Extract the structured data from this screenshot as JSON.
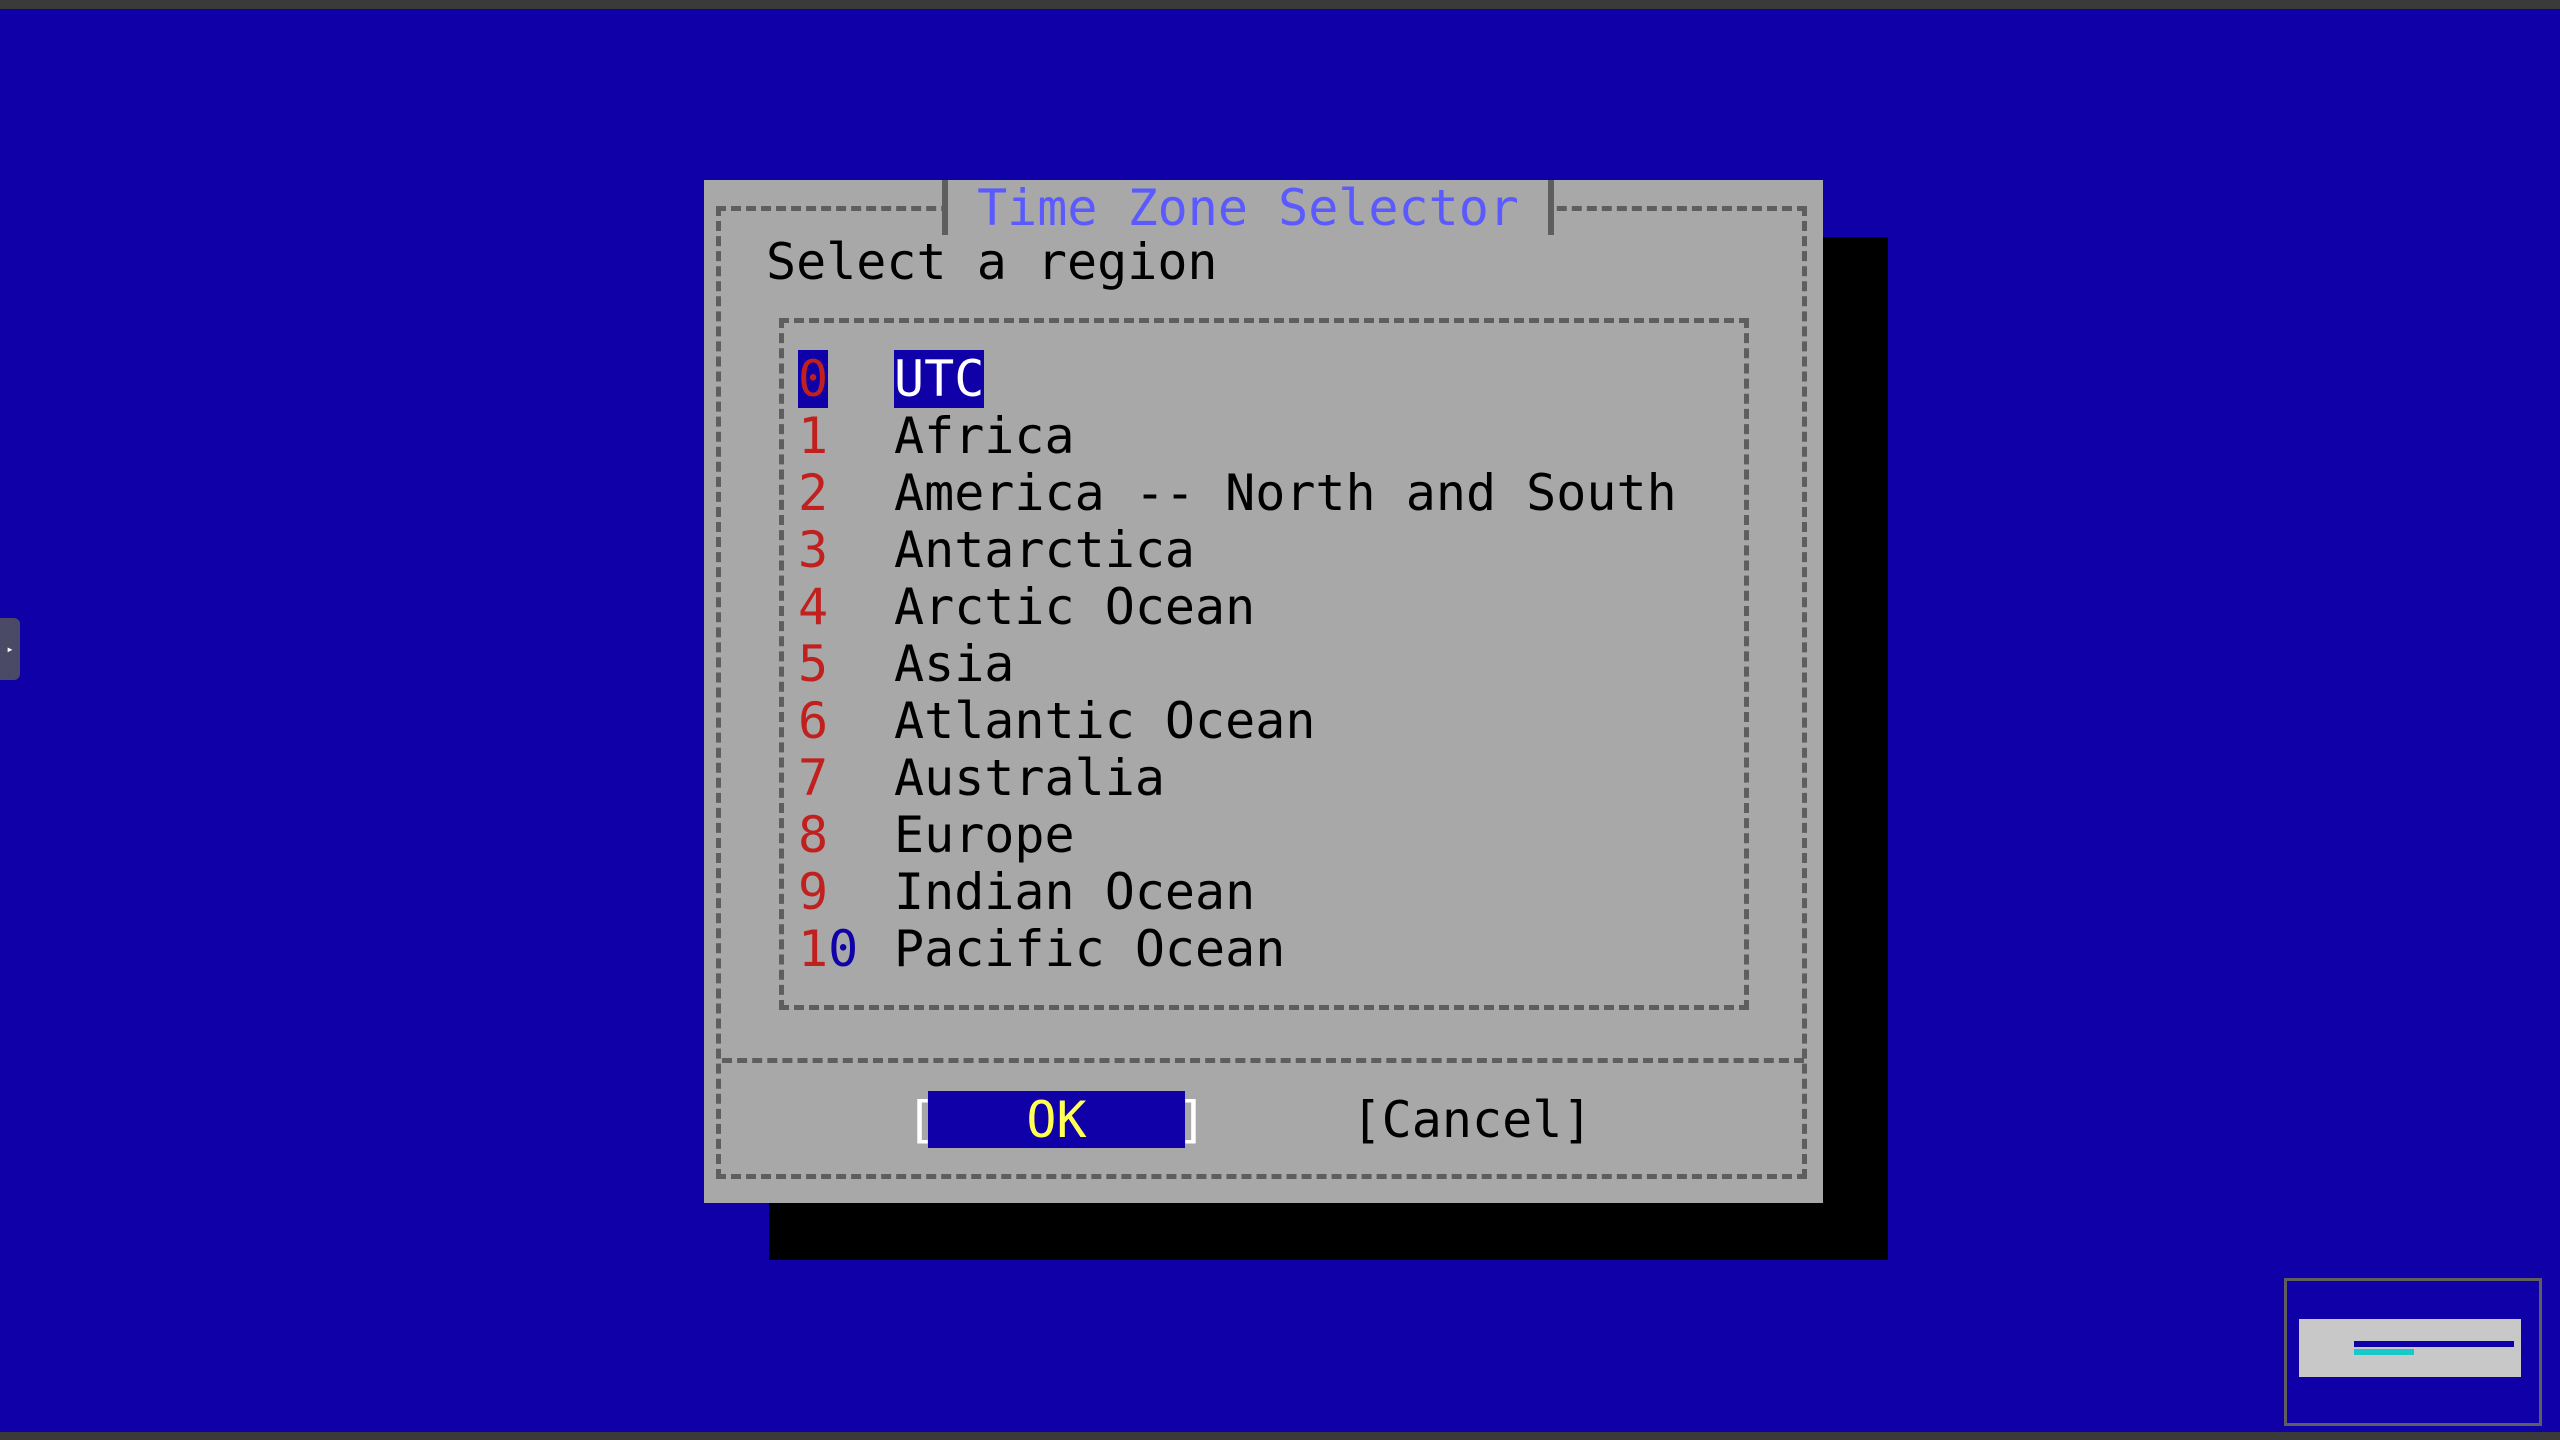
{
  "dialog": {
    "title": "Time Zone Selector",
    "prompt": "Select a region"
  },
  "menu": {
    "items": [
      {
        "key": "0",
        "label": "UTC",
        "selected": true
      },
      {
        "key": "1",
        "label": "Africa"
      },
      {
        "key": "2",
        "label": "America -- North and South"
      },
      {
        "key": "3",
        "label": "Antarctica"
      },
      {
        "key": "4",
        "label": "Arctic Ocean"
      },
      {
        "key": "5",
        "label": "Asia"
      },
      {
        "key": "6",
        "label": "Atlantic Ocean"
      },
      {
        "key": "7",
        "label": "Australia"
      },
      {
        "key": "8",
        "label": "Europe"
      },
      {
        "key": "9",
        "label": "Indian Ocean"
      },
      {
        "key": "10",
        "label": "Pacific Ocean"
      }
    ]
  },
  "buttons": {
    "ok_left": "[",
    "ok_label": "OK",
    "ok_right": "]",
    "cancel_label": "[Cancel]"
  },
  "colors": {
    "background": "#1000a8",
    "dialog": "#a8a8a8",
    "title": "#5a5aff",
    "hotkey": "#c0201e",
    "ok_text": "#ffff54"
  },
  "icons": {
    "side_handle": "play-arrow-icon"
  }
}
